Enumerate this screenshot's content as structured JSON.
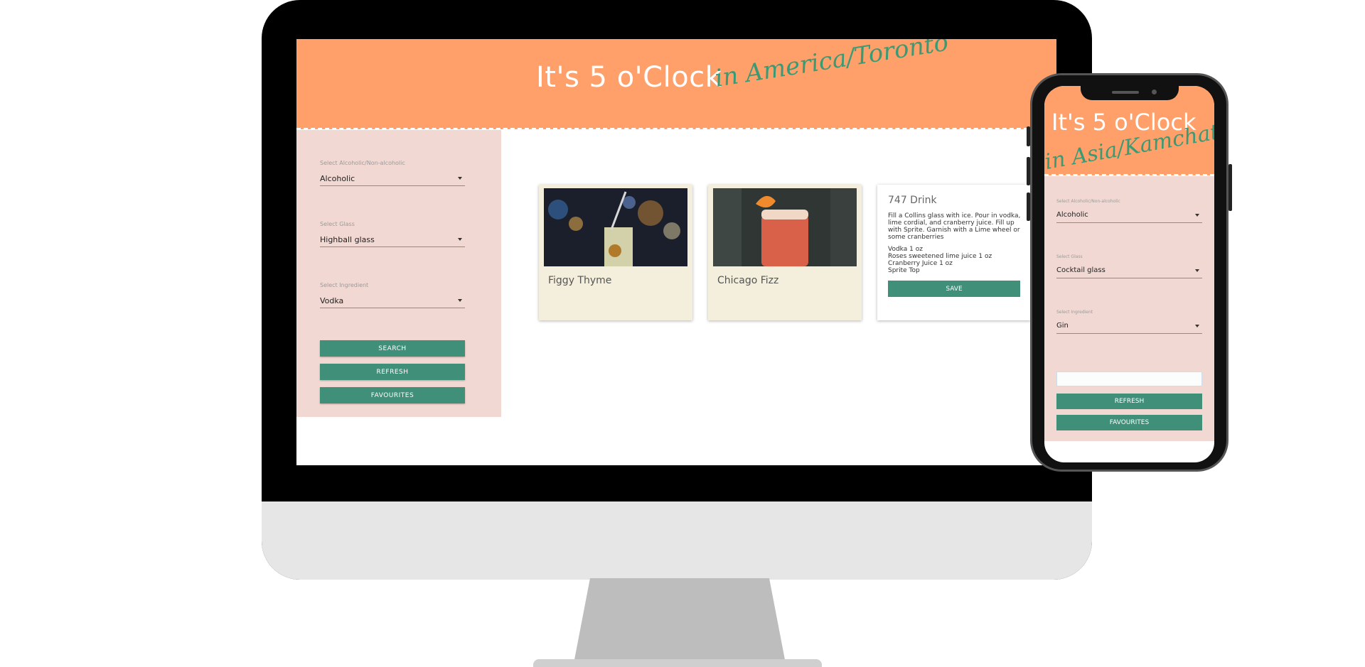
{
  "desktop": {
    "header": {
      "title": "It's 5 o'Clock",
      "timezone": "in America/Toronto"
    },
    "filters": [
      {
        "label": "Select Alcoholic/Non-alcoholic",
        "value": "Alcoholic"
      },
      {
        "label": "Select Glass",
        "value": "Highball glass"
      },
      {
        "label": "Select Ingredient",
        "value": "Vodka"
      }
    ],
    "buttons": {
      "search": "SEARCH",
      "refresh": "REFRESH",
      "favourites": "FAVOURITES"
    },
    "cards": [
      {
        "name": "Figgy Thyme"
      },
      {
        "name": "Chicago Fizz"
      }
    ],
    "detail": {
      "name": "747 Drink",
      "instructions": "Fill a Collins glass with ice. Pour in vodka, lime cordial, and cranberry juice. Fill up with Sprite. Garnish with a Lime wheel or some cranberries",
      "ingredients": [
        "Vodka 1 oz",
        "Roses sweetened lime juice 1 oz",
        "Cranberry Juice 1 oz",
        "Sprite Top"
      ],
      "save": "SAVE"
    }
  },
  "mobile": {
    "header": {
      "title": "It's 5 o'Clock",
      "timezone": "in Asia/Kamchatka"
    },
    "filters": [
      {
        "label": "Select Alcoholic/Non-alcoholic",
        "value": "Alcoholic"
      },
      {
        "label": "Select Glass",
        "value": "Cocktail glass"
      },
      {
        "label": "Select Ingredient",
        "value": "Gin"
      }
    ],
    "search_value": "",
    "buttons": {
      "refresh": "REFRESH",
      "favourites": "FAVOURITES"
    }
  },
  "colors": {
    "header": "#ff9f6a",
    "sidebar": "#f2d8d2",
    "button": "#3f8f79",
    "script": "#3a9a74",
    "card": "#f4efdc"
  }
}
